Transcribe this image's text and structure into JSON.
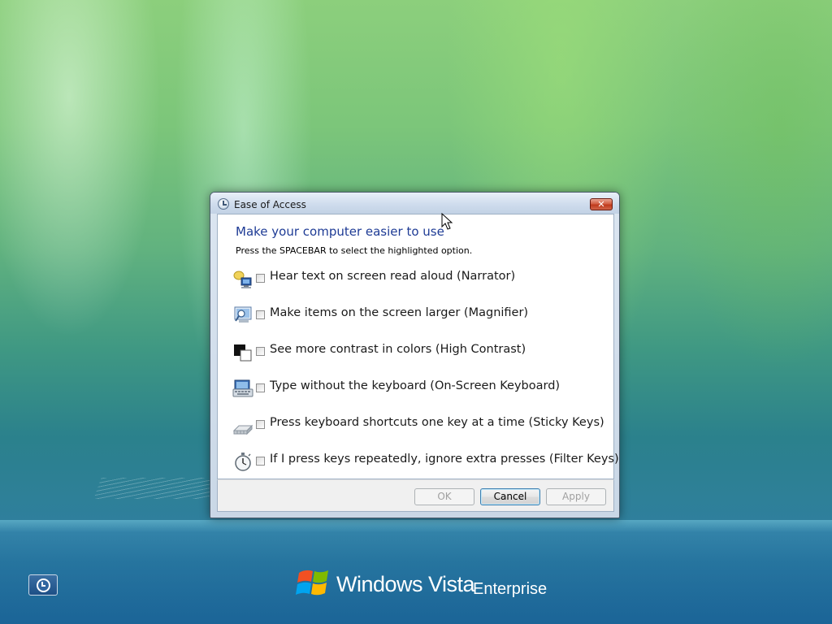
{
  "dialog": {
    "title": "Ease of Access",
    "close_label": "✕",
    "heading": "Make your computer easier to use",
    "instruction": "Press the SPACEBAR to select the highlighted option.",
    "options": [
      {
        "label": "Hear text on screen read aloud (Narrator)",
        "checked": false,
        "icon": "narrator-icon"
      },
      {
        "label": "Make items on the screen larger (Magnifier)",
        "checked": false,
        "icon": "magnifier-icon"
      },
      {
        "label": "See more contrast in colors (High Contrast)",
        "checked": false,
        "icon": "high-contrast-icon"
      },
      {
        "label": "Type without the keyboard (On-Screen Keyboard)",
        "checked": false,
        "icon": "on-screen-keyboard-icon"
      },
      {
        "label": "Press keyboard shortcuts one key at a time (Sticky Keys)",
        "checked": false,
        "icon": "sticky-keys-icon"
      },
      {
        "label": "If I press keys repeatedly, ignore extra presses (Filter Keys)",
        "checked": false,
        "icon": "filter-keys-icon"
      }
    ],
    "buttons": {
      "ok": "OK",
      "cancel": "Cancel",
      "apply": "Apply"
    }
  },
  "brand": {
    "main": "Windows Vista",
    "edition": "Enterprise"
  },
  "colors": {
    "heading": "#1e3b95",
    "close_button": "#c8432a"
  }
}
